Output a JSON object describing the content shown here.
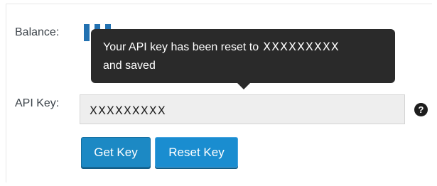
{
  "balance": {
    "label": "Balance:"
  },
  "tooltip": {
    "message_line1": "Your API key has been reset to",
    "message_value": "XXXXXXXXX",
    "message_line2": "and saved"
  },
  "api_key": {
    "label": "API Key:",
    "value": "XXXXXXXXX"
  },
  "help": {
    "glyph": "?",
    "icon": "help-question-icon"
  },
  "buttons": {
    "get_key": "Get Key",
    "reset_key": "Reset Key"
  },
  "colors": {
    "accent": "#1c89c4",
    "tooltip_bg": "#2a2a2a",
    "input_bg": "#eeeeee"
  }
}
